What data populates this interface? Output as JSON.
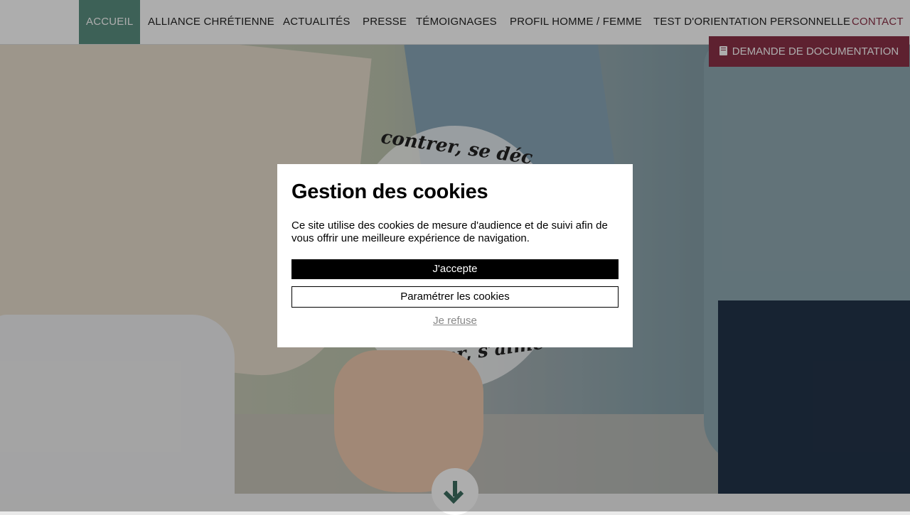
{
  "nav": {
    "items": [
      {
        "label": "ACCUEIL"
      },
      {
        "label": "ALLIANCE CHRÉTIENNE"
      },
      {
        "label": "ACTUALITÉS"
      },
      {
        "label": "PRESSE"
      },
      {
        "label": "TÉMOIGNAGES"
      },
      {
        "label": "PROFIL HOMME / FEMME"
      },
      {
        "label": "TEST D'ORIENTATION PERSONNELLE"
      },
      {
        "label": "CONTACT"
      }
    ],
    "active_index": 0,
    "accent_color": "#8b3147",
    "active_color": "#5a8f80"
  },
  "documentation_button": {
    "label": "DEMANDE DE DOCUMENTATION",
    "icon": "book-icon"
  },
  "hero": {
    "emblem_top": "contrer, se déc",
    "emblem_bottom": "estimer, s’aime",
    "scroll_icon": "arrow-down-icon"
  },
  "cookie_modal": {
    "title": "Gestion des cookies",
    "text": "Ce site utilise des cookies de mesure d'audience et de suivi afin de vous offrir une meilleure expérience de navigation.",
    "accept_label": "J'accepte",
    "settings_label": "Paramétrer les cookies",
    "refuse_label": "Je refuse"
  }
}
